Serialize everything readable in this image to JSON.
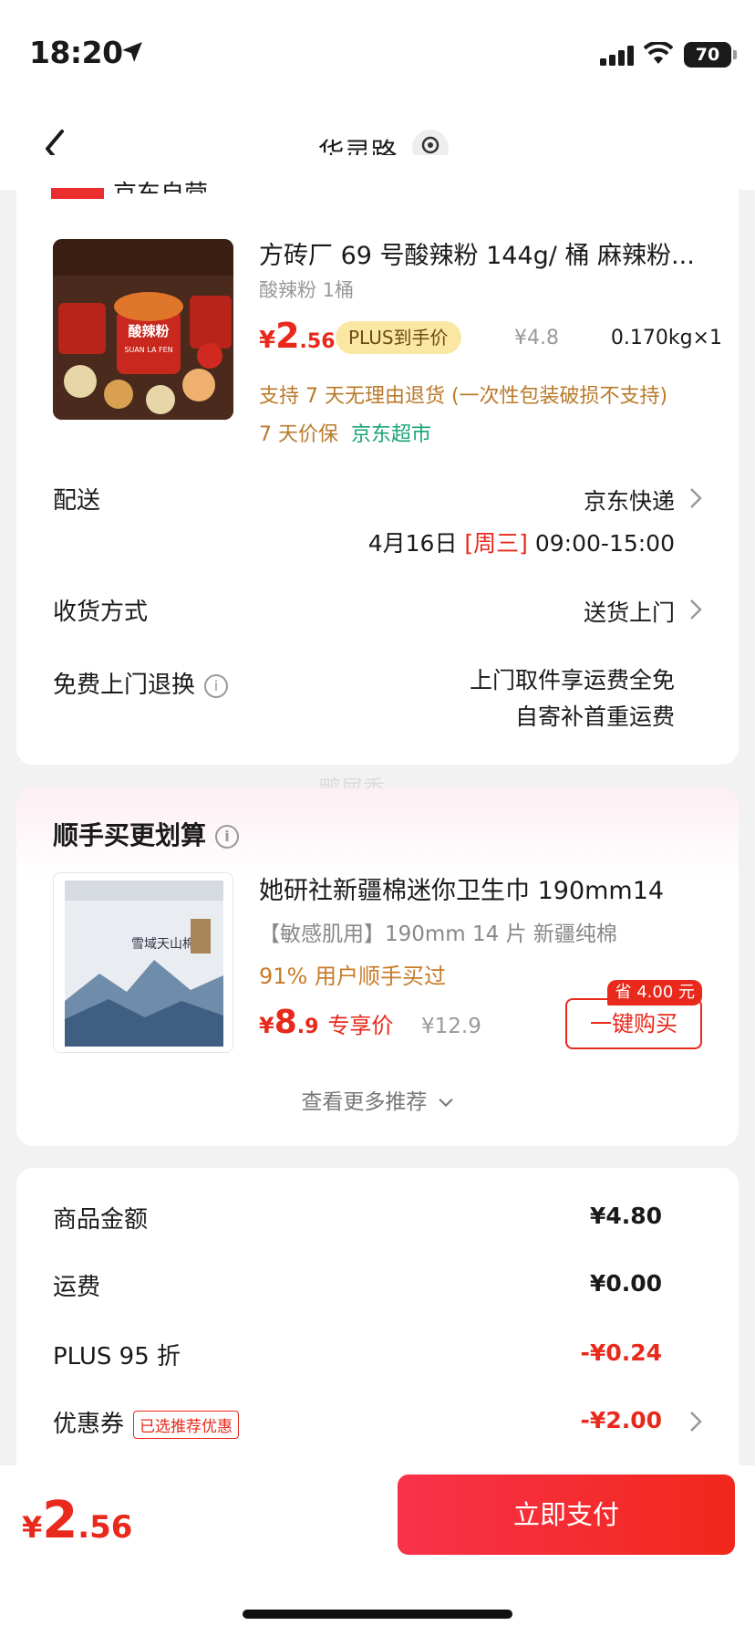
{
  "status_bar": {
    "time": "18:20",
    "battery": "70"
  },
  "nav": {
    "title": "华灵路",
    "back_icon": "chevron-left-icon",
    "location_icon": "location-pin-icon"
  },
  "shop": {
    "name": "京东自营"
  },
  "product": {
    "title": "方砖厂 69 号酸辣粉 144g/ 桶 麻辣粉...",
    "spec": "酸辣粉  1桶",
    "price_yen": "¥",
    "price_int": "2",
    "price_dec": ".56",
    "plus_badge": "PLUS到手价",
    "orig_price": "¥4.8",
    "weight": "0.170kg×1",
    "return_note": "支持 7 天无理由退货 (一次性包装破损不支持)",
    "price_protect": "7 天价保",
    "jd_supermarket": "京东超市",
    "image_text_1": "酸辣粉",
    "image_text_2": "SUAN LA FEN"
  },
  "delivery": {
    "label": "配送",
    "value": "京东快递",
    "date": "4月16日",
    "weekday": "[周三]",
    "time": "09:00-15:00"
  },
  "receive": {
    "label": "收货方式",
    "value": "送货上门"
  },
  "free_return": {
    "label": "免费上门退换",
    "line1": "上门取件享运费全免",
    "line2": "自寄补首重运费"
  },
  "watermark": "鸭屎香",
  "recommend": {
    "title": "顺手买更划算",
    "item_title": "她研社新疆棉迷你卫生巾 190mm14",
    "item_spec": "【敏感肌用】190mm 14 片 新疆纯棉",
    "bought": "91% 用户顺手买过",
    "price_yen": "¥",
    "price_int": "8",
    "price_dec": ".9",
    "price_tag": "专享价",
    "orig_price": "¥12.9",
    "save_badge": "省 4.00 元",
    "buy_button": "一键购买",
    "more": "查看更多推荐",
    "image_text": "雪域天山棉"
  },
  "summary": {
    "goods_label": "商品金额",
    "goods_value": "¥4.80",
    "freight_label": "运费",
    "freight_value": "¥0.00",
    "plus_label": "PLUS 95 折",
    "plus_value": "-¥0.24",
    "coupon_label": "优惠券",
    "coupon_tag": "已选推荐优惠",
    "coupon_value": "-¥2.00"
  },
  "bottom": {
    "total_yen": "¥",
    "total_int": "2",
    "total_dec": ".56",
    "pay_button": "立即支付"
  }
}
